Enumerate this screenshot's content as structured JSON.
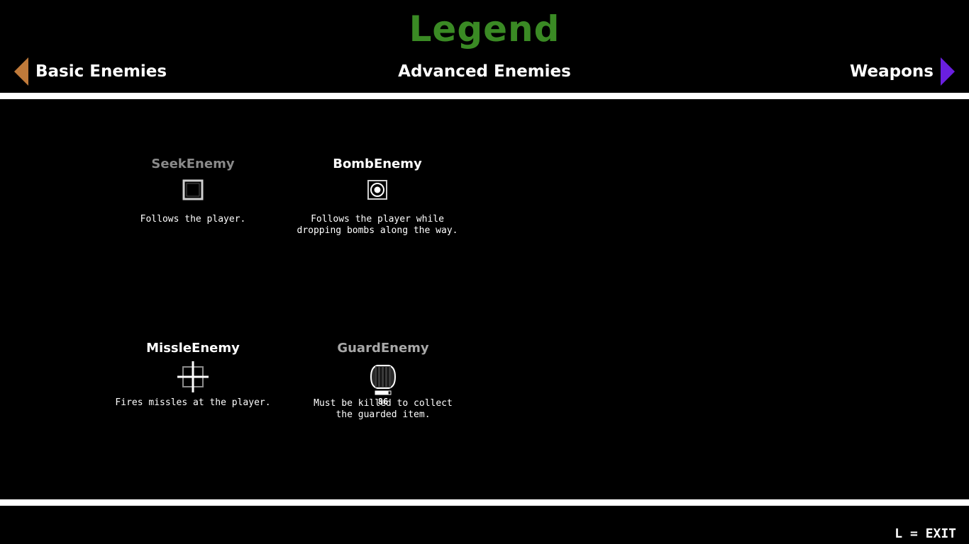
{
  "header": {
    "title": "Legend",
    "title_color": "#3a8a24",
    "current_page": "Advanced Enemies",
    "prev_page": "Basic Enemies",
    "next_page": "Weapons",
    "prev_arrow_color": "#c07a3a",
    "next_arrow_color": "#6a1fe0",
    "prev_arrow_icon": "triangle-left-icon",
    "next_arrow_icon": "triangle-right-icon"
  },
  "enemies": [
    {
      "name": "SeekEnemy",
      "name_color": "#8a8a8a",
      "icon": "seek-enemy-square-icon",
      "description": "Follows the player."
    },
    {
      "name": "BombEnemy",
      "name_color": "#ffffff",
      "icon": "bomb-enemy-target-icon",
      "description": "Follows the player while\ndropping bombs along the way."
    },
    {
      "name": "MissleEnemy",
      "name_color": "#ffffff",
      "icon": "missle-enemy-crosshair-icon",
      "description": "Fires missles at the player."
    },
    {
      "name": "GuardEnemy",
      "name_color": "#a8a8a8",
      "icon": "guard-enemy-barrel-icon",
      "health": "86",
      "health_fraction": 0.86,
      "description": "Must be killed to collect\nthe guarded item."
    }
  ],
  "footer": {
    "exit_hint": "L = EXIT"
  }
}
